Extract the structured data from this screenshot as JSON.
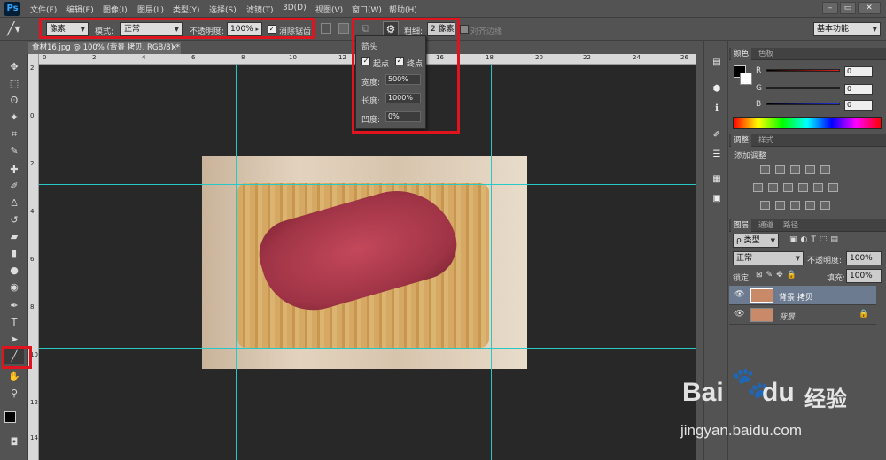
{
  "app": {
    "logo": "Ps"
  },
  "menu": [
    "文件(F)",
    "编辑(E)",
    "图像(I)",
    "图层(L)",
    "类型(Y)",
    "选择(S)",
    "滤镜(T)",
    "3D(D)",
    "视图(V)",
    "窗口(W)",
    "帮助(H)"
  ],
  "window_controls": {
    "minimize": "–",
    "restore": "▭",
    "close": "✕"
  },
  "options": {
    "mode_select": "像素",
    "mode_label": "模式:",
    "blend_mode": "正常",
    "opacity_label": "不透明度:",
    "opacity_value": "100%",
    "antialias_label": "消除锯齿",
    "weight_label": "粗细:",
    "weight_value": "2 像素",
    "align_edges_label": "对齐边缘",
    "workspace": "基本功能"
  },
  "arrow_popup": {
    "title": "箭头",
    "start_label": "起点",
    "end_label": "终点",
    "width_label": "宽度:",
    "width_value": "500%",
    "length_label": "长度:",
    "length_value": "1000%",
    "concavity_label": "凹度:",
    "concavity_value": "0%"
  },
  "document": {
    "tab_title": "食材16.jpg @ 100% (背景 拷贝, RGB/8) *",
    "close": "×"
  },
  "ruler_h_ticks": [
    "0",
    "2",
    "4",
    "6",
    "8",
    "10",
    "12",
    "14",
    "16",
    "18",
    "20",
    "22",
    "24",
    "26"
  ],
  "ruler_v_ticks": [
    "2",
    "0",
    "2",
    "4",
    "6",
    "8",
    "10",
    "12",
    "14",
    "16"
  ],
  "color_panel": {
    "tabs": [
      "颜色",
      "色板"
    ],
    "channels": [
      {
        "label": "R",
        "value": "0",
        "color": "#e02020"
      },
      {
        "label": "G",
        "value": "0",
        "color": "#20c020"
      },
      {
        "label": "B",
        "value": "0",
        "color": "#2030e0"
      }
    ]
  },
  "adjust_panel": {
    "tabs": [
      "调整",
      "样式"
    ],
    "title": "添加调整"
  },
  "layers_panel": {
    "tabs": [
      "图层",
      "通道",
      "路径"
    ],
    "filter_label": "ρ 类型",
    "blend_mode": "正常",
    "opacity_label": "不透明度:",
    "opacity_value": "100%",
    "lock_label": "锁定:",
    "fill_label": "填充:",
    "fill_value": "100%",
    "layers": [
      {
        "name": "背景 拷贝",
        "selected": true,
        "locked": false
      },
      {
        "name": "背景",
        "selected": false,
        "locked": true
      }
    ]
  },
  "watermark": {
    "brand": "Bai",
    "brand2": "du",
    "cn": "经验",
    "url": "jingyan.baidu.com"
  }
}
